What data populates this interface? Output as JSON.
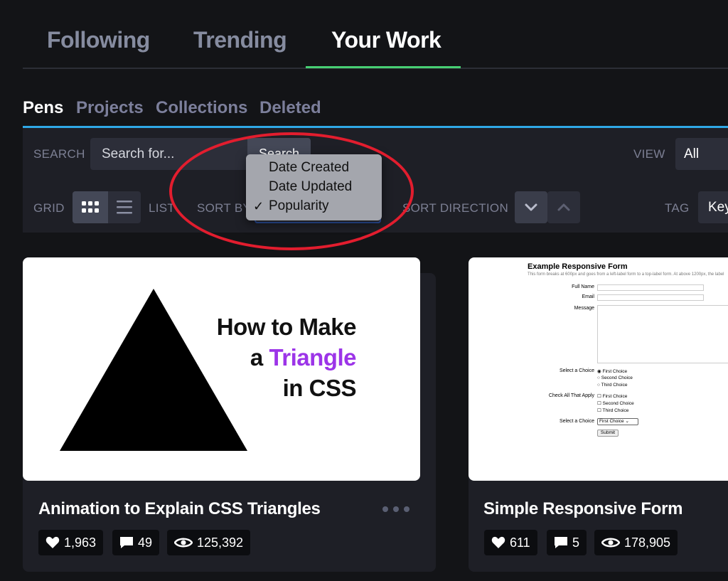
{
  "top_tabs": {
    "following": "Following",
    "trending": "Trending",
    "your_work": "Your Work"
  },
  "sub_tabs": {
    "pens": "Pens",
    "projects": "Projects",
    "collections": "Collections",
    "deleted": "Deleted"
  },
  "filters": {
    "search_label": "SEARCH",
    "search_placeholder": "Search for...",
    "search_button": "Search",
    "view_label": "VIEW",
    "view_value": "All",
    "grid_label": "GRID",
    "list_label": "LIST",
    "sort_by_label": "SORT BY",
    "sort_direction_label": "SORT DIRECTION",
    "tag_label": "TAG",
    "tag_placeholder": "Key"
  },
  "sort_dropdown": {
    "options": [
      "Date Created",
      "Date Updated",
      "Popularity"
    ],
    "selected": "Popularity",
    "check": "✓"
  },
  "cards": [
    {
      "title": "Animation to Explain CSS Triangles",
      "thumb_lines": [
        "How to Make",
        "a",
        "Triangle",
        "in CSS"
      ],
      "likes": "1,963",
      "comments": "49",
      "views": "125,392"
    },
    {
      "title": "Simple Responsive Form",
      "preview": {
        "title": "Example Responsive Form",
        "subtitle": "This form breaks at 600px and goes from a left-label form to a top-label form. At above 1200px, the label",
        "full_name": "Full Name",
        "email": "Email",
        "message": "Message",
        "select_choice": "Select a Choice",
        "check_all": "Check All That Apply",
        "choice_1": "First Choice",
        "choice_2": "Second Choice",
        "choice_3": "Third Choice",
        "select_value": "First Choice",
        "submit": "Submit"
      },
      "likes": "611",
      "comments": "5",
      "views": "178,905"
    }
  ],
  "colors": {
    "accent_green": "#47cf73",
    "accent_blue": "#2fa8e6",
    "annotation_red": "#e21d2e",
    "triangle_purple": "#9c34e8"
  }
}
